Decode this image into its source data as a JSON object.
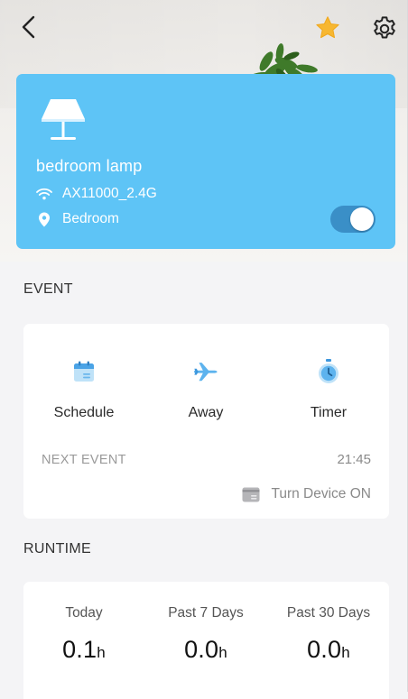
{
  "header": {
    "back_icon": "chevron-left-icon",
    "favorite_icon": "star-icon",
    "settings_icon": "gear-icon",
    "favorite_color": "#f7b731"
  },
  "device": {
    "icon": "lamp-icon",
    "name": "bedroom lamp",
    "network": "AX11000_2.4G",
    "location": "Bedroom",
    "power_on": true,
    "card_color": "#5ec4f6"
  },
  "event": {
    "title": "EVENT",
    "items": [
      {
        "label": "Schedule",
        "icon": "calendar-icon"
      },
      {
        "label": "Away",
        "icon": "airplane-icon"
      },
      {
        "label": "Timer",
        "icon": "stopwatch-icon"
      }
    ],
    "next_event_label": "NEXT EVENT",
    "next_event_time": "21:45",
    "next_event_action": "Turn Device ON"
  },
  "runtime": {
    "title": "RUNTIME",
    "columns": [
      {
        "label": "Today",
        "value": "0.1",
        "unit": "h"
      },
      {
        "label": "Past 7 Days",
        "value": "0.0",
        "unit": "h"
      },
      {
        "label": "Past 30 Days",
        "value": "0.0",
        "unit": "h"
      }
    ]
  }
}
